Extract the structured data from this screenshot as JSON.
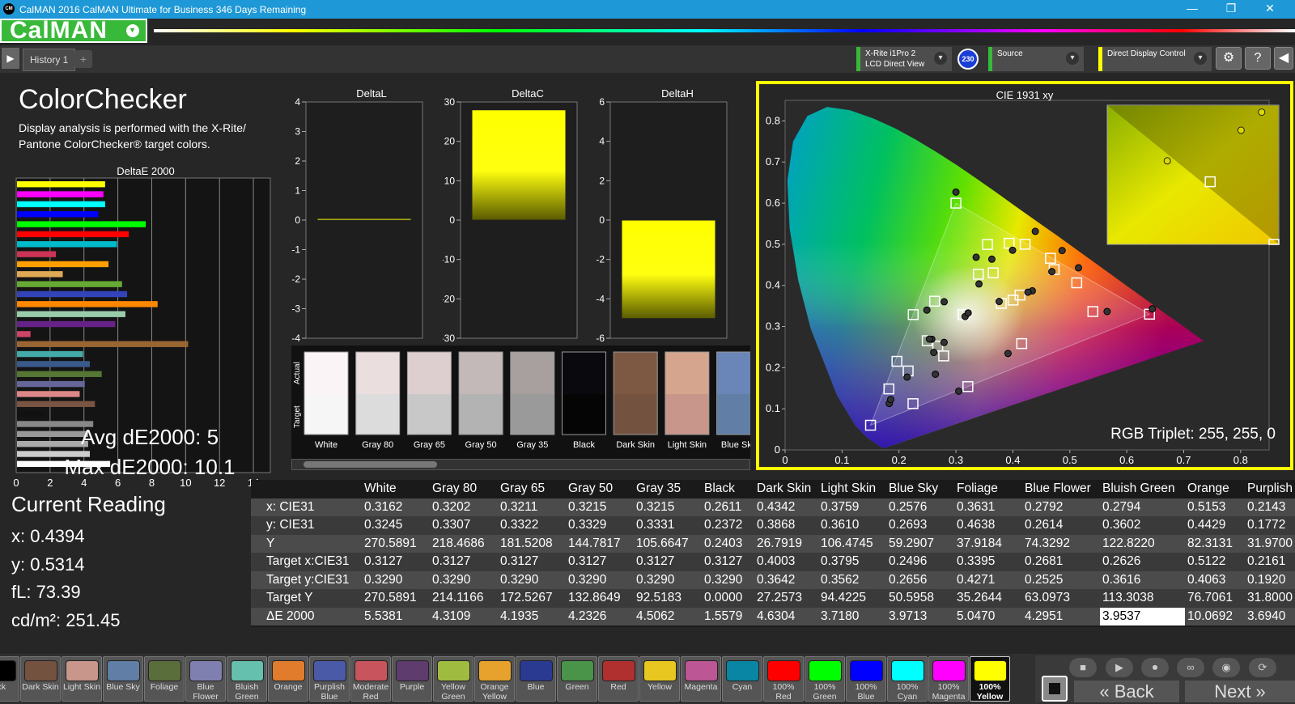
{
  "window": {
    "title": "CalMAN 2016 CalMAN Ultimate for Business 346 Days Remaining",
    "icon_text": "CM",
    "minimize": "—",
    "maximize": "❐",
    "close": "✕"
  },
  "app": {
    "logo": "CalMAN",
    "logo_dropdown": "▾"
  },
  "tabs": {
    "history_label": "History 1",
    "add_label": "+",
    "prev": "▶",
    "next": "◀"
  },
  "devices": {
    "meter_line1": "X-Rite i1Pro 2",
    "meter_line2": "LCD Direct View",
    "meter_badge": "230",
    "source_label": "Source",
    "display_label": "Direct Display Control",
    "chevron": "▾"
  },
  "toolbar": {
    "settings_icon": "⚙",
    "help_icon": "?",
    "collapse_icon": "◀"
  },
  "page": {
    "title": "ColorChecker",
    "description": "Display analysis is performed with the X-Rite/ Pantone ColorChecker® target colors."
  },
  "de_chart": {
    "title": "DeltaE 2000",
    "xticks": [
      "0",
      "2",
      "4",
      "6",
      "8",
      "10",
      "12",
      "14"
    ],
    "xmax": 15,
    "bars": [
      {
        "value": 5.2,
        "color": "#ffff00"
      },
      {
        "value": 5.1,
        "color": "#ff00ff"
      },
      {
        "value": 5.2,
        "color": "#00ffff"
      },
      {
        "value": 4.8,
        "color": "#0000ff"
      },
      {
        "value": 7.6,
        "color": "#00ff00"
      },
      {
        "value": 6.6,
        "color": "#ff0000"
      },
      {
        "value": 5.9,
        "color": "#00bbcc"
      },
      {
        "value": 2.3,
        "color": "#cc3355"
      },
      {
        "value": 5.4,
        "color": "#ff9f00"
      },
      {
        "value": 2.7,
        "color": "#e0aa55"
      },
      {
        "value": 6.2,
        "color": "#66aa33"
      },
      {
        "value": 6.5,
        "color": "#3344bb"
      },
      {
        "value": 8.3,
        "color": "#ff8800"
      },
      {
        "value": 6.4,
        "color": "#99ccaa"
      },
      {
        "value": 5.8,
        "color": "#662288"
      },
      {
        "value": 0.8,
        "color": "#cc4466"
      },
      {
        "value": 10.1,
        "color": "#996633"
      },
      {
        "value": 3.9,
        "color": "#44aaaa"
      },
      {
        "value": 4.3,
        "color": "#3a5a8c"
      },
      {
        "value": 5.0,
        "color": "#557733"
      },
      {
        "value": 4.0,
        "color": "#666699"
      },
      {
        "value": 3.7,
        "color": "#dd8888"
      },
      {
        "value": 4.6,
        "color": "#7a5543"
      },
      {
        "value": 1.6,
        "color": "#111111"
      },
      {
        "value": 4.5,
        "color": "#888888"
      },
      {
        "value": 4.2,
        "color": "#999999"
      },
      {
        "value": 4.2,
        "color": "#aaaaaa"
      },
      {
        "value": 4.3,
        "color": "#cccccc"
      },
      {
        "value": 5.5,
        "color": "#ffffff"
      }
    ]
  },
  "summary": {
    "avg": "Avg dE2000: 5",
    "max": "Max dE2000: 10.1"
  },
  "current_reading": {
    "title": "Current Reading",
    "x": "x: 0.4394",
    "y": "y: 0.5314",
    "fl": "fL: 73.39",
    "cdm2": "cd/m²: 251.45"
  },
  "delta_charts": [
    {
      "title": "DeltaL",
      "ymin": -4,
      "ymax": 4,
      "yticks": [
        "4",
        "3",
        "2",
        "1",
        "0",
        "-1",
        "-2",
        "-3",
        "-4"
      ],
      "value": 0.05
    },
    {
      "title": "DeltaC",
      "ymin": -30,
      "ymax": 30,
      "yticks": [
        "30",
        "20",
        "10",
        "0",
        "-10",
        "-20",
        "-30"
      ],
      "value": 28
    },
    {
      "title": "DeltaH",
      "ymin": -6,
      "ymax": 6,
      "yticks": [
        "6",
        "4",
        "2",
        "0",
        "-2",
        "-4",
        "-6"
      ],
      "value": -5
    }
  ],
  "swatches": {
    "actual_label": "Actual",
    "target_label": "Target",
    "items": [
      {
        "name": "White",
        "actual": "#fbf4f7",
        "target": "#f6f6f6"
      },
      {
        "name": "Gray 80",
        "actual": "#ebdede",
        "target": "#dcdcdc"
      },
      {
        "name": "Gray 65",
        "actual": "#ddcfcf",
        "target": "#c8c8c8"
      },
      {
        "name": "Gray 50",
        "actual": "#c4b9b9",
        "target": "#b3b3b3"
      },
      {
        "name": "Gray 35",
        "actual": "#a8a09e",
        "target": "#9a9a9a"
      },
      {
        "name": "Black",
        "actual": "#0a0a0e",
        "target": "#050505"
      },
      {
        "name": "Dark Skin",
        "actual": "#7d5842",
        "target": "#735240"
      },
      {
        "name": "Light Skin",
        "actual": "#d6a58e",
        "target": "#c8968a"
      },
      {
        "name": "Blue Sky",
        "actual": "#6a86b8",
        "target": "#607ea6"
      }
    ]
  },
  "cie": {
    "title": "CIE 1931 xy",
    "xticks": [
      "0",
      "0.1",
      "0.2",
      "0.3",
      "0.4",
      "0.5",
      "0.6",
      "0.7",
      "0.8"
    ],
    "yticks": [
      "0",
      "0.1",
      "0.2",
      "0.3",
      "0.4",
      "0.5",
      "0.6",
      "0.7",
      "0.8"
    ],
    "rgb_triplet": "RGB Triplet: 255, 255, 0",
    "gamut": [
      [
        0.64,
        0.33
      ],
      [
        0.3,
        0.6
      ],
      [
        0.15,
        0.06
      ]
    ],
    "targets": [
      [
        0.3127,
        0.329
      ],
      [
        0.4003,
        0.3642
      ],
      [
        0.3795,
        0.3562
      ],
      [
        0.2496,
        0.2656
      ],
      [
        0.3395,
        0.4271
      ],
      [
        0.2681,
        0.2525
      ],
      [
        0.2626,
        0.3616
      ],
      [
        0.5122,
        0.4063
      ],
      [
        0.2161,
        0.192
      ],
      [
        0.64,
        0.33
      ],
      [
        0.3,
        0.6
      ],
      [
        0.15,
        0.06
      ],
      [
        0.225,
        0.329
      ],
      [
        0.321,
        0.154
      ],
      [
        0.3127,
        0.329
      ],
      [
        0.2246,
        0.1125
      ],
      [
        0.2785,
        0.2285
      ],
      [
        0.4215,
        0.5
      ],
      [
        0.466,
        0.466
      ],
      [
        0.1964,
        0.2154
      ],
      [
        0.4725,
        0.4385
      ],
      [
        0.4125,
        0.3765
      ],
      [
        0.4155,
        0.2585
      ],
      [
        0.5405,
        0.3365
      ],
      [
        0.1823,
        0.1483
      ],
      [
        0.3555,
        0.4995
      ],
      [
        0.3655,
        0.4305
      ],
      [
        0.3935,
        0.5025
      ]
    ],
    "actuals": [
      [
        0.3162,
        0.3245
      ],
      [
        0.4342,
        0.3868
      ],
      [
        0.3759,
        0.361
      ],
      [
        0.2576,
        0.2693
      ],
      [
        0.3631,
        0.4638
      ],
      [
        0.2792,
        0.2614
      ],
      [
        0.2794,
        0.3602
      ],
      [
        0.5153,
        0.4429
      ],
      [
        0.2143,
        0.1772
      ],
      [
        0.645,
        0.343
      ],
      [
        0.3,
        0.627
      ],
      [
        0.183,
        0.113
      ],
      [
        0.249,
        0.34
      ],
      [
        0.305,
        0.143
      ],
      [
        0.3215,
        0.3331
      ],
      [
        0.264,
        0.184
      ],
      [
        0.2611,
        0.2372
      ],
      [
        0.4394,
        0.5314
      ],
      [
        0.4865,
        0.4848
      ],
      [
        0.2535,
        0.2695
      ],
      [
        0.4685,
        0.4335
      ],
      [
        0.4265,
        0.3835
      ],
      [
        0.3915,
        0.2345
      ],
      [
        0.5655,
        0.3365
      ],
      [
        0.1855,
        0.1225
      ],
      [
        0.3355,
        0.4685
      ],
      [
        0.3405,
        0.4035
      ],
      [
        0.3995,
        0.4855
      ]
    ],
    "inset_points": [
      [
        0.78,
        0.82
      ],
      [
        0.35,
        0.6
      ],
      [
        0.9,
        0.95
      ]
    ]
  },
  "table": {
    "columns": [
      "",
      "White",
      "Gray 80",
      "Gray 65",
      "Gray 50",
      "Gray 35",
      "Black",
      "Dark Skin",
      "Light Skin",
      "Blue Sky",
      "Foliage",
      "Blue Flower",
      "Bluish Green",
      "Orange",
      "Purplish Blue"
    ],
    "rows": [
      {
        "label": "x: CIE31",
        "values": [
          "0.3162",
          "0.3202",
          "0.3211",
          "0.3215",
          "0.3215",
          "0.2611",
          "0.4342",
          "0.3759",
          "0.2576",
          "0.3631",
          "0.2792",
          "0.2794",
          "0.5153",
          "0.2143"
        ]
      },
      {
        "label": "y: CIE31",
        "values": [
          "0.3245",
          "0.3307",
          "0.3322",
          "0.3329",
          "0.3331",
          "0.2372",
          "0.3868",
          "0.3610",
          "0.2693",
          "0.4638",
          "0.2614",
          "0.3602",
          "0.4429",
          "0.1772"
        ]
      },
      {
        "label": "Y",
        "values": [
          "270.5891",
          "218.4686",
          "181.5208",
          "144.7817",
          "105.6647",
          "0.2403",
          "26.7919",
          "106.4745",
          "59.2907",
          "37.9184",
          "74.3292",
          "122.8220",
          "82.3131",
          "31.9700"
        ]
      },
      {
        "label": "Target x:CIE31",
        "values": [
          "0.3127",
          "0.3127",
          "0.3127",
          "0.3127",
          "0.3127",
          "0.3127",
          "0.4003",
          "0.3795",
          "0.2496",
          "0.3395",
          "0.2681",
          "0.2626",
          "0.5122",
          "0.2161"
        ]
      },
      {
        "label": "Target y:CIE31",
        "values": [
          "0.3290",
          "0.3290",
          "0.3290",
          "0.3290",
          "0.3290",
          "0.3290",
          "0.3642",
          "0.3562",
          "0.2656",
          "0.4271",
          "0.2525",
          "0.3616",
          "0.4063",
          "0.1920"
        ]
      },
      {
        "label": "Target Y",
        "values": [
          "270.5891",
          "214.1166",
          "172.5267",
          "132.8649",
          "92.5183",
          "0.0000",
          "27.2573",
          "94.4225",
          "50.5958",
          "35.2644",
          "63.0973",
          "113.3038",
          "76.7061",
          "31.8000"
        ]
      },
      {
        "label": "ΔE 2000",
        "values": [
          "5.5381",
          "4.3109",
          "4.1935",
          "4.2326",
          "4.5062",
          "1.5579",
          "4.6304",
          "3.7180",
          "3.9713",
          "5.0470",
          "4.2951",
          "3.9537",
          "10.0692",
          "3.6940"
        ]
      }
    ],
    "selected_row": 6,
    "selected_col": 11
  },
  "bottom_swatches": [
    {
      "label": "ack",
      "color": "#000000"
    },
    {
      "label": "Dark Skin",
      "color": "#735240"
    },
    {
      "label": "Light Skin",
      "color": "#c8968a"
    },
    {
      "label": "Blue Sky",
      "color": "#607ea6"
    },
    {
      "label": "Foliage",
      "color": "#5a6e3c"
    },
    {
      "label": "Blue Flower",
      "color": "#8080b0"
    },
    {
      "label": "Bluish Green",
      "color": "#66c0ae"
    },
    {
      "label": "Orange",
      "color": "#e07c2c"
    },
    {
      "label": "Purplish Blue",
      "color": "#4a5aa6"
    },
    {
      "label": "Moderate Red",
      "color": "#c8555e"
    },
    {
      "label": "Purple",
      "color": "#5e3c6e"
    },
    {
      "label": "Yellow Green",
      "color": "#a0bc40"
    },
    {
      "label": "Orange Yellow",
      "color": "#e6a22c"
    },
    {
      "label": "Blue",
      "color": "#2a3a90"
    },
    {
      "label": "Green",
      "color": "#4a944a"
    },
    {
      "label": "Red",
      "color": "#b03030"
    },
    {
      "label": "Yellow",
      "color": "#e8c820"
    },
    {
      "label": "Magenta",
      "color": "#bc5694"
    },
    {
      "label": "Cyan",
      "color": "#0886a4"
    },
    {
      "label": "100% Red",
      "color": "#ff0000"
    },
    {
      "label": "100% Green",
      "color": "#00ff00"
    },
    {
      "label": "100% Blue",
      "color": "#0000ff"
    },
    {
      "label": "100% Cyan",
      "color": "#00ffff"
    },
    {
      "label": "100% Magenta",
      "color": "#ff00ff"
    },
    {
      "label": "100% Yellow",
      "color": "#ffff00"
    }
  ],
  "controls": {
    "back": "« Back",
    "next": "Next »",
    "stop": "■",
    "play": "▶",
    "loop": "∞",
    "record": "⏺",
    "read": "◉",
    "refresh": "⟳"
  }
}
